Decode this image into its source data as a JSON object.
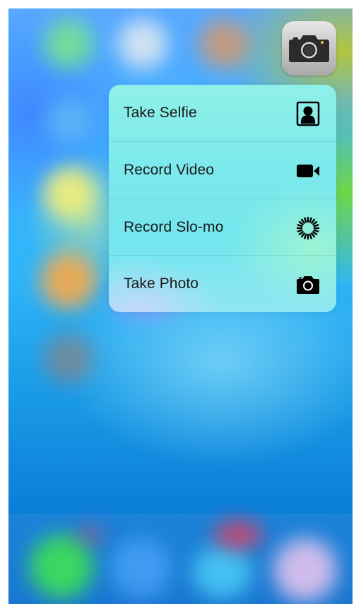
{
  "quick_actions": {
    "items": [
      {
        "label": "Take Selfie",
        "icon": "selfie-portrait-icon"
      },
      {
        "label": "Record Video",
        "icon": "video-camera-icon"
      },
      {
        "label": "Record Slo-mo",
        "icon": "slo-mo-icon"
      },
      {
        "label": "Take Photo",
        "icon": "camera-icon"
      }
    ]
  },
  "app": {
    "icon": "camera-app-icon"
  },
  "colors": {
    "menu_text": "#1b1b1b",
    "menu_background": "#7ae8ec",
    "wallpaper_top": "#58a8ff",
    "wallpaper_bottom": "#0a6fd0"
  }
}
